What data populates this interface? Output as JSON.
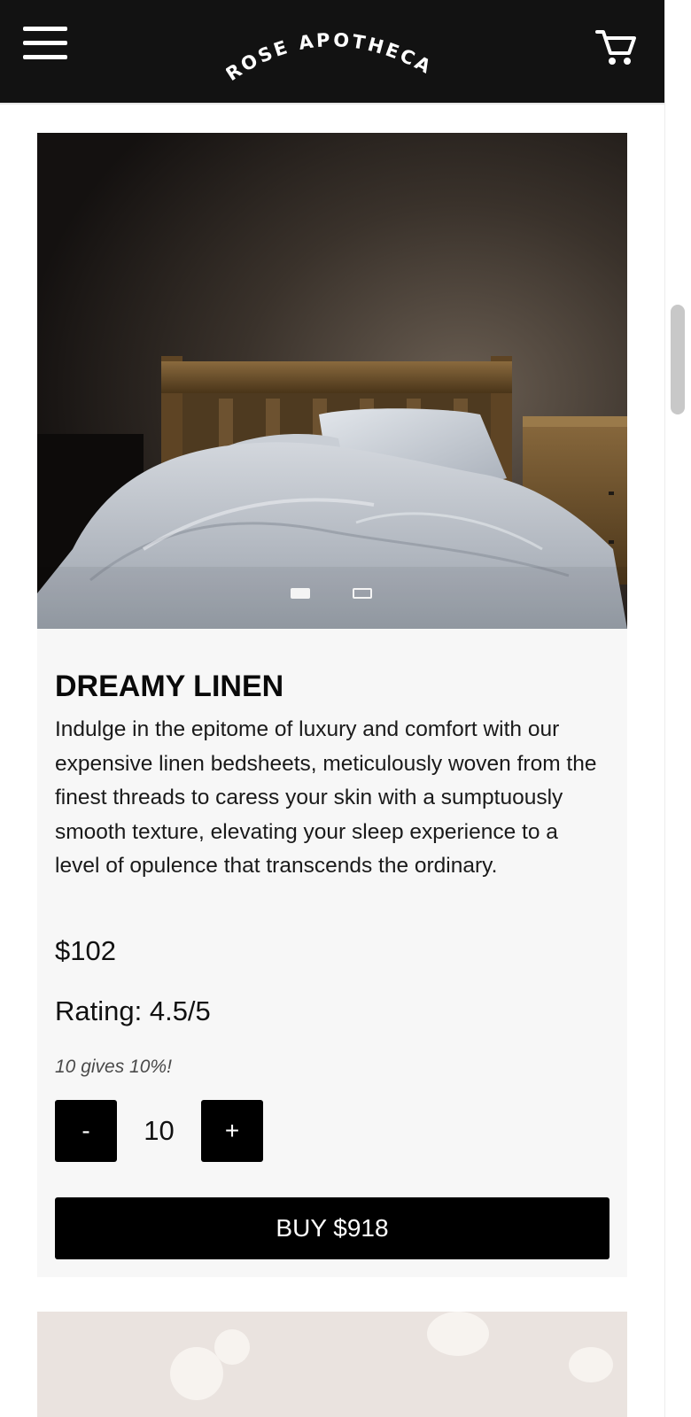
{
  "header": {
    "logo_text": "ROSE APOTHECARY",
    "menu_icon": "hamburger-menu-icon",
    "cart_icon": "shopping-cart-icon",
    "background": "#121212"
  },
  "product": {
    "image_alt": "Bed with white linen sheets and wooden headboard",
    "carousel": {
      "slide_count": 2,
      "active_slide": 1
    },
    "title": "DREAMY LINEN",
    "description": "Indulge in the epitome of luxury and comfort with our expensive linen bedsheets, meticulously woven from the finest threads to caress your skin with a sumptuously smooth texture, elevating your sleep experience to a level of opulence that transcends the ordinary.",
    "price": "$102",
    "rating": "Rating: 4.5/5",
    "promo": "10 gives 10%!",
    "quantity": {
      "minus_label": "-",
      "value": "10",
      "plus_label": "+"
    },
    "buy_label": "BUY $918"
  },
  "colors": {
    "button": "#000000",
    "card_background": "#f7f7f7"
  }
}
